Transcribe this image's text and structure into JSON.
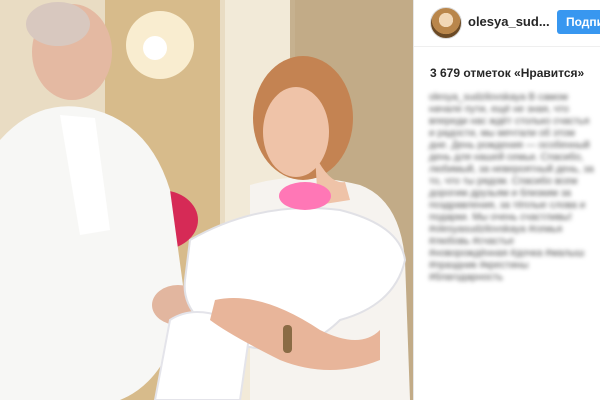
{
  "post": {
    "username": "olesya_sud...",
    "follow_label": "Подпис",
    "likes_text": "3 679 отметок «Нравится»",
    "caption_text": "olesya_sudzilovskaya В самом начале пути, ещё не зная, что впереди нас ждёт столько счастья и радости, мы мечтали об этом дне. День рождения — особенный день для нашей семьи. Спасибо, любимый, за невероятный день, за то, что ты рядом. Спасибо всем дорогим друзьям и близким за поздравления, за тёплые слова и подарки. Мы очень счастливы! #olesyasudzilovskaya #семья #любовь #счастье #новорождённая #дочка #малыш #праздник #крестины #благодарность"
  },
  "colors": {
    "accent": "#3897f0",
    "text": "#262626"
  }
}
